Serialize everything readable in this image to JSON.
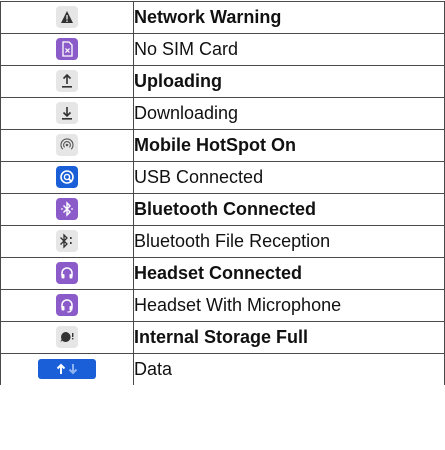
{
  "rows": [
    {
      "icon": "network-warning-icon",
      "label": "Network Warning",
      "bold": true
    },
    {
      "icon": "no-sim-card-icon",
      "label": "No SIM Card",
      "bold": false
    },
    {
      "icon": "uploading-icon",
      "label": "Uploading",
      "bold": true
    },
    {
      "icon": "downloading-icon",
      "label": "Downloading",
      "bold": false
    },
    {
      "icon": "mobile-hotspot-icon",
      "label": "Mobile HotSpot On",
      "bold": true
    },
    {
      "icon": "usb-connected-icon",
      "label": "USB Connected",
      "bold": false
    },
    {
      "icon": "bluetooth-connected-icon",
      "label": "Bluetooth Connected",
      "bold": true
    },
    {
      "icon": "bluetooth-file-reception-icon",
      "label": "Bluetooth File Reception",
      "bold": false
    },
    {
      "icon": "headset-connected-icon",
      "label": "Headset Connected",
      "bold": true
    },
    {
      "icon": "headset-microphone-icon",
      "label": "Headset With Microphone",
      "bold": false
    },
    {
      "icon": "storage-full-icon",
      "label": "Internal Storage Full",
      "bold": true
    },
    {
      "icon": "data-icon",
      "label": "Data",
      "bold": false
    }
  ],
  "colors": {
    "purple": "#8b5cc9",
    "blue": "#1a5fd8",
    "light": "#e6e6e6"
  }
}
